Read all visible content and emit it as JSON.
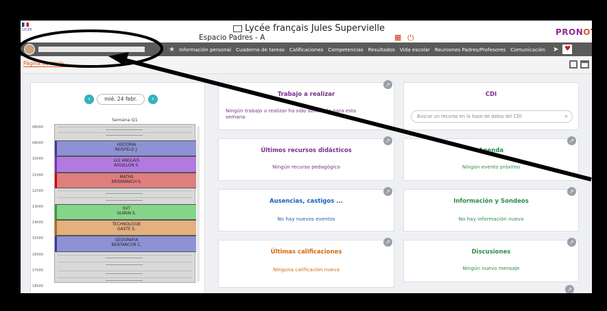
{
  "header": {
    "school_title": "Lycée français Jules Supervielle",
    "space_label": "Espacio Padres - A",
    "brand_parts": [
      "PRON",
      "O",
      "TE"
    ],
    "school_logo_text": "LYCÉE"
  },
  "nav": {
    "items": [
      "Información personal",
      "Cuaderno de tareas",
      "Calificaciones",
      "Competencias",
      "Resultados",
      "Vida escolar",
      "Reuniones Padres/Profesores",
      "Comunicación"
    ]
  },
  "toolbar": {
    "home_label": "Página de inicio"
  },
  "schedule": {
    "date_label": "mié. 24 febr.",
    "week_label": "Semana Q1",
    "hours": [
      "08h00",
      "09h00",
      "10h00",
      "11h00",
      "12h00",
      "13h00",
      "14h00",
      "15h00",
      "16h00",
      "17h00",
      "18h00"
    ],
    "lessons": [
      {
        "subject": "HISTORIA",
        "teacher": "REISFELD J.",
        "color": "#8e92d4",
        "border": "#3b3e9a"
      },
      {
        "subject": "LV2 ANGLAIS",
        "teacher": "AGUILLON S.",
        "color": "#b27ae0",
        "border": "#7b2fc5"
      },
      {
        "subject": "MATHS",
        "teacher": "KRISMANICH S.",
        "color": "#e07e7e",
        "border": "#d40000"
      },
      {
        "subject": "SVT",
        "teacher": "GUIRIN S.",
        "color": "#86d489",
        "border": "#3a9a3e"
      },
      {
        "subject": "TECHNOLOGIE",
        "teacher": "GASTÉ S.",
        "color": "#e3b07e",
        "border": "#b56a1c"
      },
      {
        "subject": "GEOGRAFIA",
        "teacher": "BENTANCOR C.",
        "color": "#8e92d4",
        "border": "#3b3e9a"
      }
    ]
  },
  "cards": {
    "work": {
      "title": "Trabajo a realizar",
      "text": "Ningún trabajo a realizar ha sido solicitado para esta semana",
      "color": "#7a2f8c"
    },
    "cdi": {
      "title": "CDI",
      "search_placeholder": "Buscar un recurso en la base de datos del CDI",
      "color": "#7a2f8c"
    },
    "resources": {
      "title": "Últimos recursos didácticos",
      "text": "Ningún recurso pedagógico",
      "color": "#7a2f8c"
    },
    "agenda": {
      "title": "Agenda",
      "text": "Ningún evento próximo",
      "color": "#2a8c4a"
    },
    "absences": {
      "title": "Ausencias, castigos ...",
      "text": "No hay nuevos eventos",
      "color": "#1a5fb4"
    },
    "info": {
      "title": "Información y Sondeos",
      "text": "No hay información nueva",
      "color": "#2a8c4a"
    },
    "grades": {
      "title": "Últimas calificaciones",
      "text": "Ninguna calificación nueva",
      "color": "#d06a10"
    },
    "discussions": {
      "title": "Discusiones",
      "text": "Ningún nuevo mensaje",
      "color": "#2a8c4a"
    }
  },
  "colors": {
    "nav_bg": "#5b5b5b",
    "accent": "#e4571e",
    "nav_button": "#36b1bd"
  }
}
